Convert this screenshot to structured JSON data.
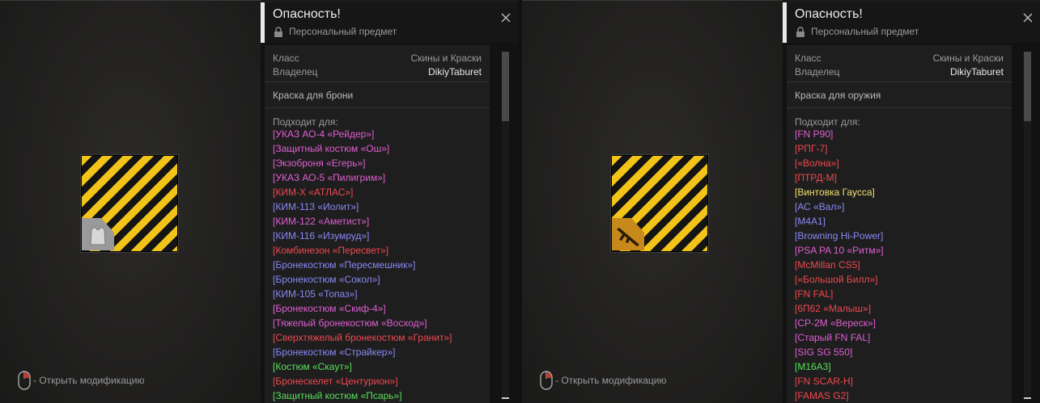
{
  "hint_text": "- Открыть модификацию",
  "colors": {
    "stripe_yellow": "#f2c318",
    "stripe_black": "#141414",
    "pink": "#e05fd2",
    "red": "#f0484f",
    "blue": "#8a88f5",
    "green": "#57e05a",
    "yellow": "#f3e170"
  },
  "left": {
    "badge_icon": "armor-vest-icon",
    "title": "Опасность!",
    "subtitle": "Персональный предмет",
    "class_label": "Класс",
    "class_value": "Скины и Краски",
    "owner_label": "Владелец",
    "owner_value": "DikiyTaburet",
    "description": "Краска для брони",
    "fits_title": "Подходит для:",
    "fits": [
      {
        "text": "[УКАЗ АО-4 «Рейдер»]",
        "color": "#e05fd2"
      },
      {
        "text": "[Защитный костюм «Ош»]",
        "color": "#e05fd2"
      },
      {
        "text": "[Экзоброня «Егерь»]",
        "color": "#e05fd2"
      },
      {
        "text": "[УКАЗ АО-5 «Пилигрим»]",
        "color": "#e05fd2"
      },
      {
        "text": "[КИМ-Х «АТЛАС»]",
        "color": "#f0484f"
      },
      {
        "text": "[КИМ-113 «Иолит»]",
        "color": "#8a88f5"
      },
      {
        "text": "[КИМ-122 «Аметист»]",
        "color": "#e05fd2"
      },
      {
        "text": "[КИМ-116 «Изумруд»]",
        "color": "#8a88f5"
      },
      {
        "text": "[Комбинезон «Пересвет»]",
        "color": "#f0484f"
      },
      {
        "text": "[Бронекостюм «Пересмешник»]",
        "color": "#8a88f5"
      },
      {
        "text": "[Бронекостюм «Сокол»]",
        "color": "#8a88f5"
      },
      {
        "text": "[КИМ-105 «Топаз»]",
        "color": "#8a88f5"
      },
      {
        "text": "[Бронекостюм «Скиф-4»]",
        "color": "#e05fd2"
      },
      {
        "text": "[Тяжелый бронекостюм «Восход»]",
        "color": "#e05fd2"
      },
      {
        "text": "[Сверхтяжелый бронекостюм «Гранит»]",
        "color": "#f0484f"
      },
      {
        "text": "[Бронекостюм «Страйкер»]",
        "color": "#8a88f5"
      },
      {
        "text": "[Костюм «Скаут»]",
        "color": "#57e05a"
      },
      {
        "text": "[Бронескелет «Центурион»]",
        "color": "#f0484f"
      },
      {
        "text": "[Защитный костюм «Псарь»]",
        "color": "#57e05a"
      }
    ]
  },
  "right": {
    "badge_icon": "rifle-icon",
    "title": "Опасность!",
    "subtitle": "Персональный предмет",
    "class_label": "Класс",
    "class_value": "Скины и Краски",
    "owner_label": "Владелец",
    "owner_value": "DikiyTaburet",
    "description": "Краска для оружия",
    "fits_title": "Подходит для:",
    "fits": [
      {
        "text": "[FN P90]",
        "color": "#e05fd2"
      },
      {
        "text": "[РПГ-7]",
        "color": "#f0484f"
      },
      {
        "text": "[«Волна»]",
        "color": "#f0484f"
      },
      {
        "text": "[ПТРД-М]",
        "color": "#f0484f"
      },
      {
        "text": "[Винтовка Гаусса]",
        "color": "#f3e170"
      },
      {
        "text": "[АС «Вал»]",
        "color": "#8a88f5"
      },
      {
        "text": "[M4A1]",
        "color": "#8a88f5"
      },
      {
        "text": "[Browning Hi-Power]",
        "color": "#8a88f5"
      },
      {
        "text": "[PSA PA 10 «Ритм»]",
        "color": "#e05fd2"
      },
      {
        "text": "[McMillan CS5]",
        "color": "#f0484f"
      },
      {
        "text": "[«Большой Билл»]",
        "color": "#f0484f"
      },
      {
        "text": "[FN FAL]",
        "color": "#f0484f"
      },
      {
        "text": "[6П62 «Малыш»]",
        "color": "#f0484f"
      },
      {
        "text": "[СР-2М «Вереск»]",
        "color": "#e05fd2"
      },
      {
        "text": "[Старый FN FAL]",
        "color": "#e05fd2"
      },
      {
        "text": "[SIG SG 550]",
        "color": "#e05fd2"
      },
      {
        "text": "[M16A3]",
        "color": "#57e05a"
      },
      {
        "text": "[FN SCAR-H]",
        "color": "#f0484f"
      },
      {
        "text": "[FAMAS G2]",
        "color": "#f0484f"
      }
    ]
  }
}
